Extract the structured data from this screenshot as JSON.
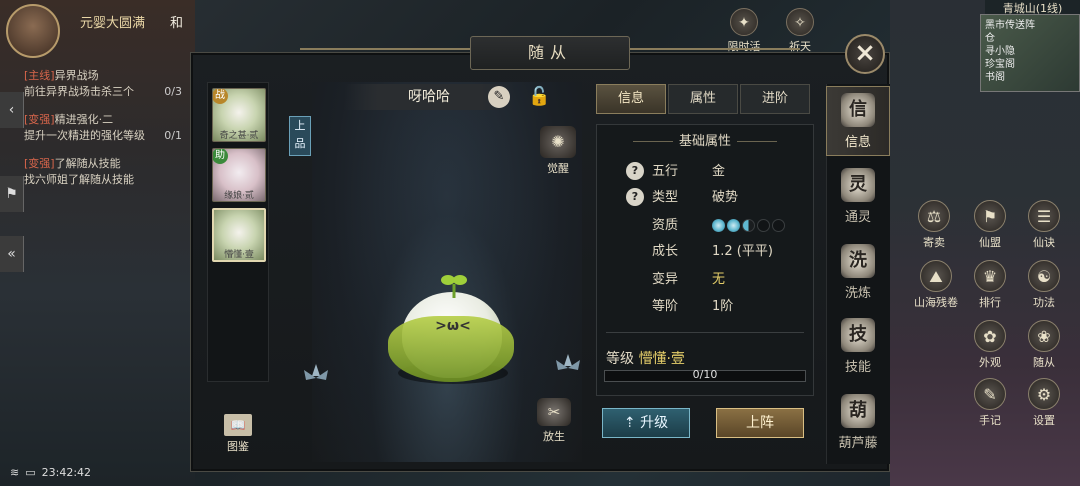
{
  "hud": {
    "player_name": "元婴大圆满",
    "player_name_extra": "和",
    "time": "23:42:42",
    "map_title": "青城山(1线)",
    "map_labels": "黑市传送阵\n仓\n寻小隐\n珍宝阁\n书阁",
    "top_icons": [
      "限时活动",
      "祈天"
    ],
    "quests": [
      {
        "tag": "[主线]",
        "title": "异界战场",
        "desc": "前往异界战场击杀三个",
        "count": "0/3"
      },
      {
        "tag": "[变强]",
        "title": "精进强化·二",
        "desc": "提升一次精进的强化等级",
        "count": "0/1"
      },
      {
        "tag": "[变强]",
        "title": "了解随从技能",
        "desc": "找六师姐了解随从技能",
        "count": ""
      }
    ],
    "right_menu": [
      "寄卖",
      "仙盟",
      "仙诀",
      "山海残卷",
      "排行",
      "功法",
      "外观",
      "随从",
      "手记",
      "设置"
    ]
  },
  "panel": {
    "title": "随从",
    "pet_name": "呀哈哈",
    "grade": "上品",
    "awaken_label": "觉醒",
    "release_label": "放生",
    "handbook_label": "图鉴",
    "slots": [
      {
        "badge": "战",
        "name": "奇之甚·贰",
        "badge_color": "#b8862a"
      },
      {
        "badge": "助",
        "name": "缘娘·贰",
        "badge_color": "#3b8a3b"
      },
      {
        "badge": "",
        "name": "懵懂·壹",
        "badge_color": ""
      }
    ],
    "tabs": [
      {
        "label": "信息",
        "active": true
      },
      {
        "label": "属性",
        "active": false
      },
      {
        "label": "进阶",
        "active": false
      }
    ],
    "section_title": "基础属性",
    "stats": [
      {
        "key": "五行",
        "value": "金",
        "help": true
      },
      {
        "key": "类型",
        "value": "破势",
        "help": true
      },
      {
        "key": "资质",
        "value": "",
        "help": false,
        "aptitude": [
          "on",
          "on",
          "half",
          "off",
          "off"
        ]
      },
      {
        "key": "成长",
        "value": "1.2 (平平)",
        "help": false
      },
      {
        "key": "变异",
        "value": "无",
        "help": false,
        "warn": true
      },
      {
        "key": "等阶",
        "value": "1阶",
        "help": false
      }
    ],
    "level_prefix": "等级",
    "level_name": "懵懂·壹",
    "xp_text": "0/10",
    "xp_ratio": 0,
    "btn_upgrade": "升级",
    "btn_deploy": "上阵",
    "side_tabs": [
      {
        "label": "信息",
        "icon": "信",
        "active": true
      },
      {
        "label": "通灵",
        "icon": "灵",
        "active": false
      },
      {
        "label": "洗炼",
        "icon": "洗",
        "active": false
      },
      {
        "label": "技能",
        "icon": "技",
        "active": false
      },
      {
        "label": "葫芦藤",
        "icon": "葫",
        "active": false
      }
    ]
  }
}
